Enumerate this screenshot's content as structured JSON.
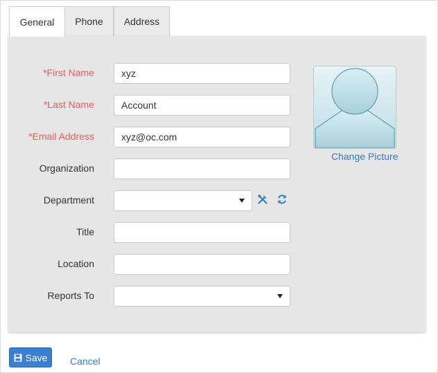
{
  "tabs": [
    {
      "label": "General",
      "active": true
    },
    {
      "label": "Phone",
      "active": false
    },
    {
      "label": "Address",
      "active": false
    }
  ],
  "form": {
    "first_name": {
      "label": "*First Name",
      "value": "xyz"
    },
    "last_name": {
      "label": "*Last Name",
      "value": "Account"
    },
    "email": {
      "label": "*Email Address",
      "value": "xyz@oc.com"
    },
    "organization": {
      "label": "Organization",
      "value": ""
    },
    "department": {
      "label": "Department",
      "value": ""
    },
    "title": {
      "label": "Title",
      "value": ""
    },
    "location": {
      "label": "Location",
      "value": ""
    },
    "reports_to": {
      "label": "Reports To",
      "value": ""
    }
  },
  "icons": {
    "department_tools": "tools-icon",
    "department_refresh": "refresh-icon",
    "save": "save-icon"
  },
  "picture": {
    "change_label": "Change Picture"
  },
  "actions": {
    "save_label": "Save",
    "cancel_label": "Cancel"
  },
  "colors": {
    "required_label": "#ee5b5b",
    "link": "#3a79c2",
    "primary_button": "#3a7fd1",
    "panel_bg": "#e6e6e6"
  }
}
